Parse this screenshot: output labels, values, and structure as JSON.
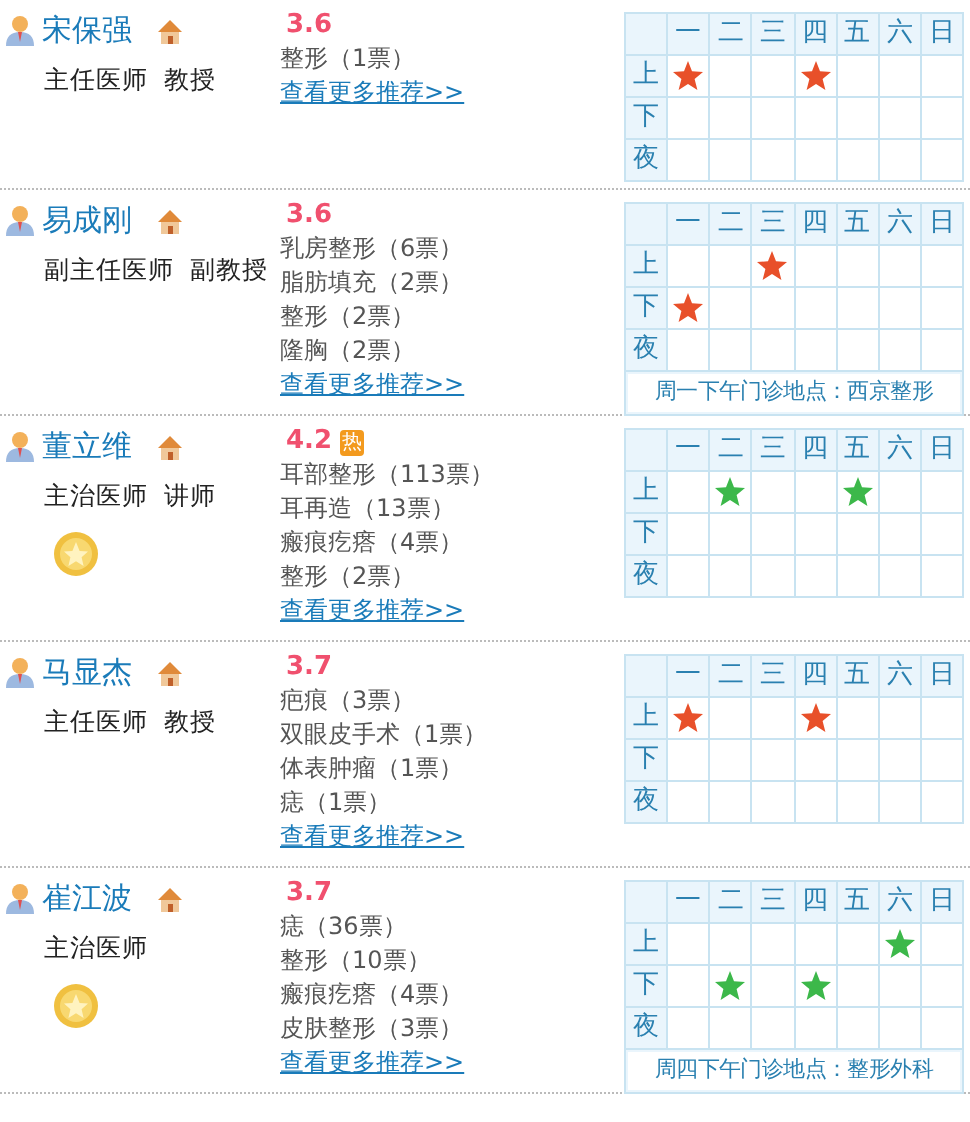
{
  "doctors": [
    {
      "name": "宋保强",
      "title": "主任医师  教授",
      "medal": false,
      "rating": "3.6",
      "specialties": [
        "整形（1票）"
      ],
      "more_link": "查看更多推荐>>",
      "schedule": {
        "days": [
          "一",
          "二",
          "三",
          "四",
          "五",
          "六",
          "日"
        ],
        "rows": [
          {
            "label": "上",
            "cells": [
              {
                "star": true,
                "color": "#e8502a"
              },
              {
                "star": false
              },
              {
                "star": false
              },
              {
                "star": true,
                "color": "#e8502a"
              },
              {
                "star": false
              },
              {
                "star": false
              },
              {
                "star": false
              }
            ]
          },
          {
            "label": "下",
            "cells": [
              {
                "star": false
              },
              {
                "star": false
              },
              {
                "star": false
              },
              {
                "star": false
              },
              {
                "star": false
              },
              {
                "star": false
              },
              {
                "star": false
              }
            ]
          },
          {
            "label": "夜",
            "cells": [
              {
                "star": false
              },
              {
                "star": false
              },
              {
                "star": false
              },
              {
                "star": false
              },
              {
                "star": false
              },
              {
                "star": false
              },
              {
                "star": false
              }
            ]
          }
        ]
      }
    },
    {
      "name": "易成刚",
      "title": "副主任医师  副教授",
      "medal": false,
      "rating": "3.6",
      "specialties": [
        "乳房整形（6票）",
        "脂肪填充（2票）",
        "整形（2票）",
        "隆胸（2票）"
      ],
      "more_link": "查看更多推荐>>",
      "schedule": {
        "days": [
          "一",
          "二",
          "三",
          "四",
          "五",
          "六",
          "日"
        ],
        "rows": [
          {
            "label": "上",
            "cells": [
              {
                "star": false
              },
              {
                "star": false
              },
              {
                "star": true,
                "color": "#e8502a"
              },
              {
                "star": false
              },
              {
                "star": false
              },
              {
                "star": false
              },
              {
                "star": false
              }
            ]
          },
          {
            "label": "下",
            "cells": [
              {
                "star": true,
                "color": "#e8502a"
              },
              {
                "star": false
              },
              {
                "star": false
              },
              {
                "star": false
              },
              {
                "star": false
              },
              {
                "star": false
              },
              {
                "star": false
              }
            ]
          },
          {
            "label": "夜",
            "cells": [
              {
                "star": false
              },
              {
                "star": false
              },
              {
                "star": false
              },
              {
                "star": false
              },
              {
                "star": false
              },
              {
                "star": false
              },
              {
                "star": false
              }
            ]
          }
        ],
        "note": "周一下午门诊地点：西京整形"
      }
    },
    {
      "name": "董立维",
      "title": "主治医师  讲师",
      "medal": true,
      "rating": "4.2",
      "hot": "热",
      "specialties": [
        "耳部整形（113票）",
        "耳再造（13票）",
        "瘢痕疙瘩（4票）",
        "整形（2票）"
      ],
      "more_link": "查看更多推荐>>",
      "schedule": {
        "days": [
          "一",
          "二",
          "三",
          "四",
          "五",
          "六",
          "日"
        ],
        "rows": [
          {
            "label": "上",
            "cells": [
              {
                "star": false
              },
              {
                "star": true,
                "color": "#3cb84a"
              },
              {
                "star": false
              },
              {
                "star": false
              },
              {
                "star": true,
                "color": "#3cb84a"
              },
              {
                "star": false
              },
              {
                "star": false
              }
            ]
          },
          {
            "label": "下",
            "cells": [
              {
                "star": false
              },
              {
                "star": false
              },
              {
                "star": false
              },
              {
                "star": false
              },
              {
                "star": false
              },
              {
                "star": false
              },
              {
                "star": false
              }
            ]
          },
          {
            "label": "夜",
            "cells": [
              {
                "star": false
              },
              {
                "star": false
              },
              {
                "star": false
              },
              {
                "star": false
              },
              {
                "star": false
              },
              {
                "star": false
              },
              {
                "star": false
              }
            ]
          }
        ]
      }
    },
    {
      "name": "马显杰",
      "title": "主任医师  教授",
      "medal": false,
      "rating": "3.7",
      "specialties": [
        "疤痕（3票）",
        "双眼皮手术（1票）",
        "体表肿瘤（1票）",
        "痣（1票）"
      ],
      "more_link": "查看更多推荐>>",
      "schedule": {
        "days": [
          "一",
          "二",
          "三",
          "四",
          "五",
          "六",
          "日"
        ],
        "rows": [
          {
            "label": "上",
            "cells": [
              {
                "star": true,
                "color": "#e8502a"
              },
              {
                "star": false
              },
              {
                "star": false
              },
              {
                "star": true,
                "color": "#e8502a"
              },
              {
                "star": false
              },
              {
                "star": false
              },
              {
                "star": false
              }
            ]
          },
          {
            "label": "下",
            "cells": [
              {
                "star": false
              },
              {
                "star": false
              },
              {
                "star": false
              },
              {
                "star": false
              },
              {
                "star": false
              },
              {
                "star": false
              },
              {
                "star": false
              }
            ]
          },
          {
            "label": "夜",
            "cells": [
              {
                "star": false
              },
              {
                "star": false
              },
              {
                "star": false
              },
              {
                "star": false
              },
              {
                "star": false
              },
              {
                "star": false
              },
              {
                "star": false
              }
            ]
          }
        ]
      }
    },
    {
      "name": "崔江波",
      "title": "主治医师",
      "medal": true,
      "rating": "3.7",
      "specialties": [
        "痣（36票）",
        "整形（10票）",
        "瘢痕疙瘩（4票）",
        "皮肤整形（3票）"
      ],
      "more_link": "查看更多推荐>>",
      "schedule": {
        "days": [
          "一",
          "二",
          "三",
          "四",
          "五",
          "六",
          "日"
        ],
        "rows": [
          {
            "label": "上",
            "cells": [
              {
                "star": false
              },
              {
                "star": false
              },
              {
                "star": false
              },
              {
                "star": false
              },
              {
                "star": false
              },
              {
                "star": true,
                "color": "#3cb84a"
              },
              {
                "star": false
              }
            ]
          },
          {
            "label": "下",
            "cells": [
              {
                "star": false
              },
              {
                "star": true,
                "color": "#3cb84a"
              },
              {
                "star": false
              },
              {
                "star": true,
                "color": "#3cb84a"
              },
              {
                "star": false
              },
              {
                "star": false
              },
              {
                "star": false
              }
            ]
          },
          {
            "label": "夜",
            "cells": [
              {
                "star": false
              },
              {
                "star": false
              },
              {
                "star": false
              },
              {
                "star": false
              },
              {
                "star": false
              },
              {
                "star": false
              },
              {
                "star": false
              }
            ]
          }
        ],
        "note": "周四下午门诊地点：整形外科"
      }
    }
  ]
}
